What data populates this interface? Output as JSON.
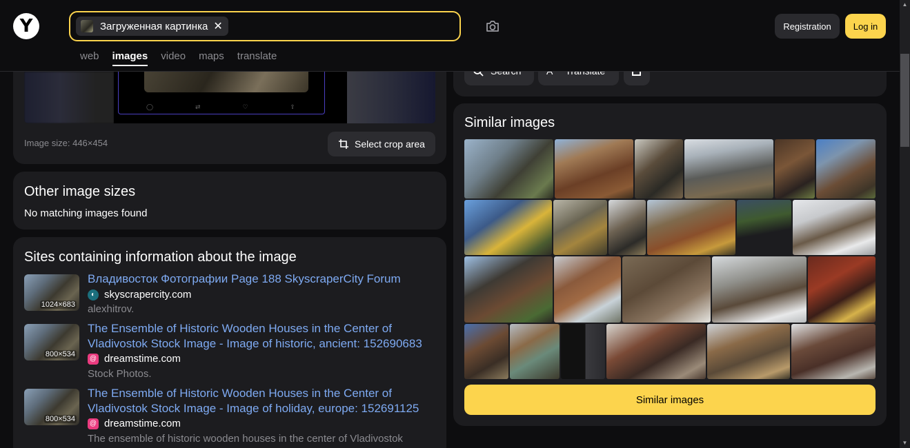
{
  "header": {
    "logo": "Y",
    "search_chip_label": "Загруженная картинка",
    "tabs": [
      {
        "label": "web"
      },
      {
        "label": "images"
      },
      {
        "label": "video"
      },
      {
        "label": "maps"
      },
      {
        "label": "translate"
      }
    ],
    "active_tab": "images",
    "registration_label": "Registration",
    "login_label": "Log in"
  },
  "preview": {
    "image_size": "Image size: 446×454",
    "crop_label": "Select crop area"
  },
  "other_sizes": {
    "title": "Other image sizes",
    "message": "No matching images found"
  },
  "sites": {
    "title": "Sites containing information about the image",
    "items": [
      {
        "dimensions": "1024×683",
        "title": "Владивосток Фотографии Page 188 SkyscraperCity Forum",
        "domain": "skyscrapercity.com",
        "description": "alexhitrov."
      },
      {
        "dimensions": "800×534",
        "title": "The Ensemble of Historic Wooden Houses in the Center of Vladivostok Stock Image - Image of historic, ancient: 152690683",
        "domain": "dreamstime.com",
        "description": "Stock Photos."
      },
      {
        "dimensions": "800×534",
        "title": "The Ensemble of Historic Wooden Houses in the Center of Vladivostok Stock Image - Image of holiday, europe: 152691125",
        "domain": "dreamstime.com",
        "description": "The ensemble of historic wooden houses in the center of Vladivostok"
      }
    ]
  },
  "actions": {
    "search_label": "Search",
    "translate_label": "Translate"
  },
  "similar": {
    "title": "Similar images",
    "button_label": "Similar images"
  },
  "colors": {
    "accent": "#fcd44d",
    "link": "#7eaaf2",
    "card_bg": "#1c1c1f",
    "page_bg": "#0d0d0f"
  }
}
